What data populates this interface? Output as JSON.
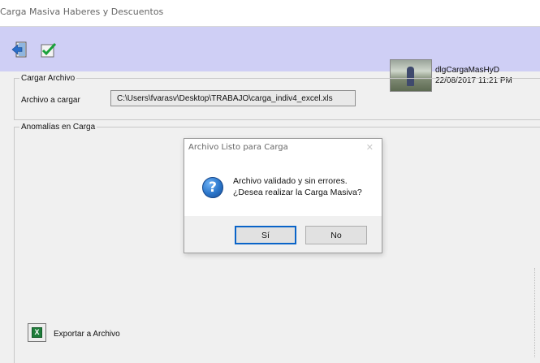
{
  "window": {
    "title": "Carga Masiva Haberes y Descuentos"
  },
  "toolbar": {
    "icons": [
      "exit-icon",
      "check-icon"
    ],
    "user": {
      "name": "dlgCargaMasHyD",
      "datetime": "22/08/2017 11:21 PM"
    }
  },
  "cargar_archivo": {
    "legend": "Cargar Archivo",
    "label": "Archivo a cargar",
    "value": "C:\\Users\\fvarasv\\Desktop\\TRABAJO\\carga_indiv4_excel.xls"
  },
  "anomalias": {
    "legend": "Anomalías en Carga",
    "export_label": "Exportar a Archivo"
  },
  "dialog": {
    "title": "Archivo Listo para Carga",
    "close": "✕",
    "icon": "question-icon",
    "line1": "Archivo validado y sin errores.",
    "line2": "¿Desea realizar la Carga Masiva?",
    "yes_label": "Sí",
    "no_label": "No"
  },
  "colors": {
    "toolbar_bg": "#cfcff5",
    "window_bg": "#f0f0f0",
    "dialog_default_border": "#0a64c8"
  }
}
